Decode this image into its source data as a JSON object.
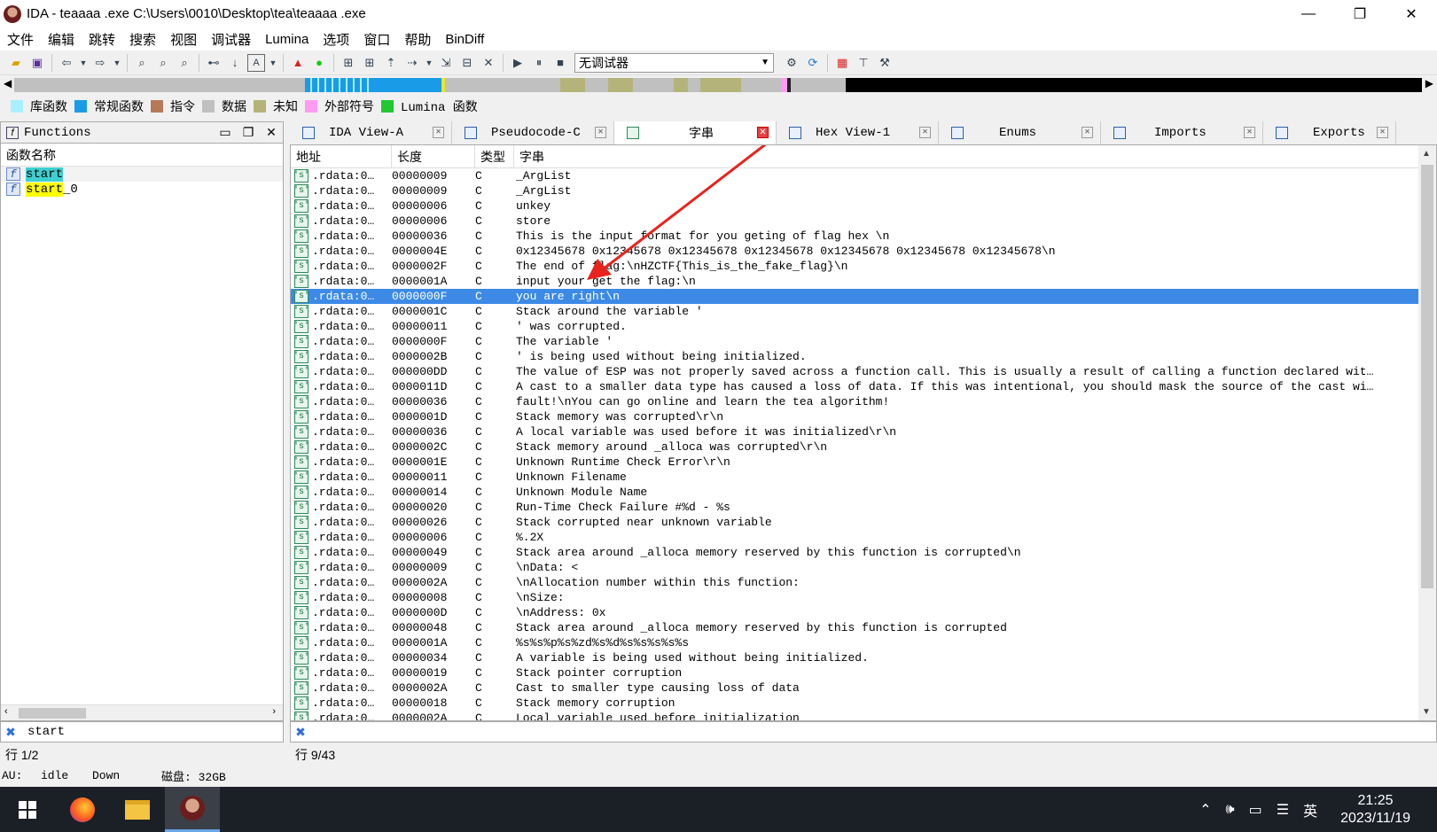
{
  "window": {
    "title": "IDA - teaaaa .exe C:\\Users\\0010\\Desktop\\tea\\teaaaa .exe",
    "minimize": "—",
    "maximize": "❐",
    "close": "✕"
  },
  "menu": [
    "文件",
    "编辑",
    "跳转",
    "搜索",
    "视图",
    "调试器",
    "Lumina",
    "选项",
    "窗口",
    "帮助",
    "BinDiff"
  ],
  "toolbar": {
    "debugger_select": "无调试器"
  },
  "legend": [
    {
      "label": "库函数",
      "color": "#a8f0ff"
    },
    {
      "label": "常规函数",
      "color": "#1a9be8"
    },
    {
      "label": "指令",
      "color": "#b47a5a"
    },
    {
      "label": "数据",
      "color": "#c0c0c0"
    },
    {
      "label": "未知",
      "color": "#b4b47a"
    },
    {
      "label": "外部符号",
      "color": "#ff9cf2"
    },
    {
      "label": "Lumina 函数",
      "color": "#22c832"
    }
  ],
  "functions_panel": {
    "title": "Functions",
    "column": "函数名称",
    "items": [
      {
        "name": "start",
        "highlight": "cyan"
      },
      {
        "name": "start",
        "suffix": "_0",
        "highlight": "yellow"
      }
    ],
    "search_value": "start",
    "status": "行 1/2"
  },
  "tabs": [
    {
      "label": "IDA View-A"
    },
    {
      "label": "Pseudocode-C"
    },
    {
      "label": "字串"
    },
    {
      "label": "Hex View-1"
    },
    {
      "label": "Enums"
    },
    {
      "label": "Imports"
    },
    {
      "label": "Exports"
    }
  ],
  "strings_view": {
    "columns": {
      "address": "地址",
      "length": "长度",
      "type": "类型",
      "string": "字串"
    },
    "rows": [
      {
        "addr": ".rdata:0…",
        "len": "00000009",
        "type": "C",
        "str": "_ArgList"
      },
      {
        "addr": ".rdata:0…",
        "len": "00000009",
        "type": "C",
        "str": "_ArgList"
      },
      {
        "addr": ".rdata:0…",
        "len": "00000006",
        "type": "C",
        "str": "unkey"
      },
      {
        "addr": ".rdata:0…",
        "len": "00000006",
        "type": "C",
        "str": "store"
      },
      {
        "addr": ".rdata:0…",
        "len": "00000036",
        "type": "C",
        "str": "This is the input format for you geting of flag hex \\n"
      },
      {
        "addr": ".rdata:0…",
        "len": "0000004E",
        "type": "C",
        "str": "0x12345678 0x12345678 0x12345678 0x12345678 0x12345678 0x12345678 0x12345678\\n"
      },
      {
        "addr": ".rdata:0…",
        "len": "0000002F",
        "type": "C",
        "str": "The end of flag:\\nHZCTF{This_is_the_fake_flag}\\n"
      },
      {
        "addr": ".rdata:0…",
        "len": "0000001A",
        "type": "C",
        "str": "input your get the flag:\\n"
      },
      {
        "addr": ".rdata:0…",
        "len": "0000000F",
        "type": "C",
        "str": "you are right\\n",
        "selected": true
      },
      {
        "addr": ".rdata:0…",
        "len": "0000001C",
        "type": "C",
        "str": "Stack around the variable '"
      },
      {
        "addr": ".rdata:0…",
        "len": "00000011",
        "type": "C",
        "str": "' was corrupted."
      },
      {
        "addr": ".rdata:0…",
        "len": "0000000F",
        "type": "C",
        "str": "The variable '"
      },
      {
        "addr": ".rdata:0…",
        "len": "0000002B",
        "type": "C",
        "str": "' is being used without being initialized."
      },
      {
        "addr": ".rdata:0…",
        "len": "000000DD",
        "type": "C",
        "str": "The value of ESP was not properly saved across a function call.  This is usually a result of calling a function declared wit…"
      },
      {
        "addr": ".rdata:0…",
        "len": "0000011D",
        "type": "C",
        "str": "A cast to a smaller data type has caused a loss of data.  If this was intentional, you should mask the source of the cast wi…"
      },
      {
        "addr": ".rdata:0…",
        "len": "00000036",
        "type": "C",
        "str": "fault!\\nYou can go online and learn the tea algorithm!"
      },
      {
        "addr": ".rdata:0…",
        "len": "0000001D",
        "type": "C",
        "str": "Stack memory was corrupted\\r\\n"
      },
      {
        "addr": ".rdata:0…",
        "len": "00000036",
        "type": "C",
        "str": "A local variable was used before it was initialized\\r\\n"
      },
      {
        "addr": ".rdata:0…",
        "len": "0000002C",
        "type": "C",
        "str": "Stack memory around _alloca was corrupted\\r\\n"
      },
      {
        "addr": ".rdata:0…",
        "len": "0000001E",
        "type": "C",
        "str": "Unknown Runtime Check Error\\r\\n"
      },
      {
        "addr": ".rdata:0…",
        "len": "00000011",
        "type": "C",
        "str": "Unknown Filename"
      },
      {
        "addr": ".rdata:0…",
        "len": "00000014",
        "type": "C",
        "str": "Unknown Module Name"
      },
      {
        "addr": ".rdata:0…",
        "len": "00000020",
        "type": "C",
        "str": "Run-Time Check Failure #%d - %s"
      },
      {
        "addr": ".rdata:0…",
        "len": "00000026",
        "type": "C",
        "str": "Stack corrupted near unknown variable"
      },
      {
        "addr": ".rdata:0…",
        "len": "00000006",
        "type": "C",
        "str": "%.2X"
      },
      {
        "addr": ".rdata:0…",
        "len": "00000049",
        "type": "C",
        "str": "Stack area around _alloca memory reserved by this function is corrupted\\n"
      },
      {
        "addr": ".rdata:0…",
        "len": "00000009",
        "type": "C",
        "str": "\\nData: <"
      },
      {
        "addr": ".rdata:0…",
        "len": "0000002A",
        "type": "C",
        "str": "\\nAllocation number within this function:"
      },
      {
        "addr": ".rdata:0…",
        "len": "00000008",
        "type": "C",
        "str": "\\nSize:"
      },
      {
        "addr": ".rdata:0…",
        "len": "0000000D",
        "type": "C",
        "str": "\\nAddress: 0x"
      },
      {
        "addr": ".rdata:0…",
        "len": "00000048",
        "type": "C",
        "str": "Stack area around _alloca memory reserved by this function is corrupted"
      },
      {
        "addr": ".rdata:0…",
        "len": "0000001A",
        "type": "C",
        "str": "%s%s%p%s%zd%s%d%s%s%s%s%s"
      },
      {
        "addr": ".rdata:0…",
        "len": "00000034",
        "type": "C",
        "str": "A variable is being used without being initialized."
      },
      {
        "addr": ".rdata:0…",
        "len": "00000019",
        "type": "C",
        "str": "Stack pointer corruption"
      },
      {
        "addr": ".rdata:0…",
        "len": "0000002A",
        "type": "C",
        "str": "Cast to smaller type causing loss of data"
      },
      {
        "addr": ".rdata:0…",
        "len": "00000018",
        "type": "C",
        "str": "Stack memory corruption"
      },
      {
        "addr": ".rdata:0…",
        "len": "0000002A",
        "type": "C",
        "str": "Local variable used before initialization"
      }
    ],
    "status": "行 9/43"
  },
  "status_bar": {
    "au": "AU:",
    "state": "idle",
    "direction": "Down",
    "disk": "磁盘: 32GB"
  },
  "taskbar": {
    "time": "21:25",
    "date": "2023/11/19",
    "ime": "英"
  },
  "colors": {
    "selection": "#3c8ae6",
    "arrow": "#e8231c"
  }
}
